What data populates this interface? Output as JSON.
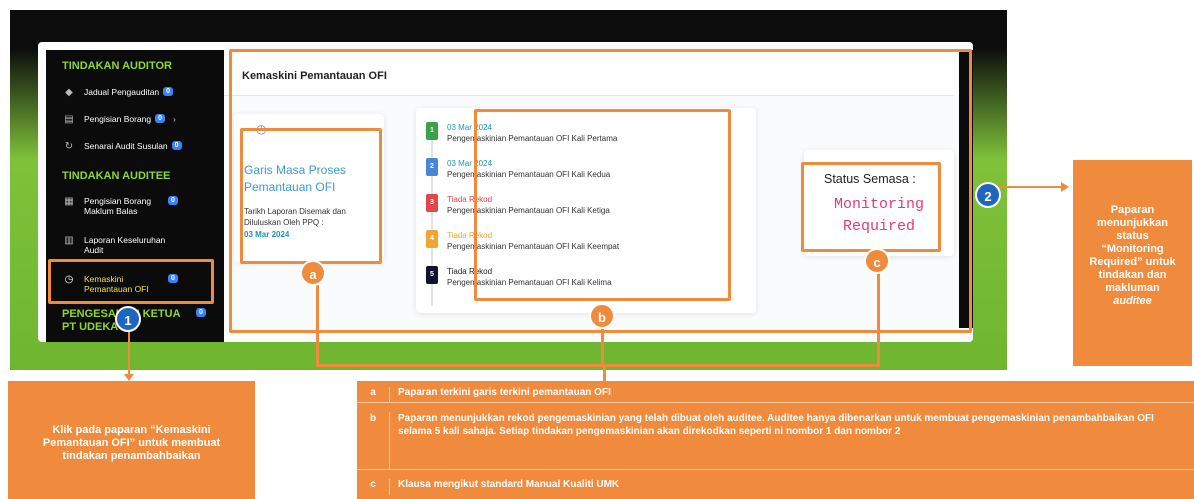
{
  "sidebar": {
    "section_auditor": "TINDAKAN AUDITOR",
    "section_auditee": "TINDAKAN AUDITEE",
    "section_pengesahan": "PENGESAHAN KETUA PT UDEKA",
    "items": [
      {
        "label": "Jadual Pengauditan",
        "badge": "0"
      },
      {
        "label": "Pengisian Borang",
        "badge": "0"
      },
      {
        "label": "Senarai Audit Susulan",
        "badge": "0"
      },
      {
        "label": "Pengisian Borang Maklum Balas",
        "badge": "0"
      },
      {
        "label": "Laporan Keseluruhan Audit",
        "badge": ""
      },
      {
        "label": "Kemaskini Pemantauan OFI",
        "badge": "0"
      }
    ],
    "pengesahan_badge": "0"
  },
  "main": {
    "title": "Kemaskini Pemantauan OFI"
  },
  "garis_masa": {
    "title": "Garis Masa Proses Pemantauan OFI",
    "subtitle": "Tarikh Laporan Disemak dan Diluluskan Oleh PPQ :",
    "date": "03 Mar 2024"
  },
  "timeline": [
    {
      "num": "1",
      "date": "03 Mar 2024",
      "text": "Pengemaskinian Pemantauan OFI Kali Pertama",
      "color": "#3aa34a",
      "date_color": "#1a96b8"
    },
    {
      "num": "2",
      "date": "03 Mar 2024",
      "text": "Pengemaskinian Pemantauan OFI Kali Kedua",
      "color": "#4a86d8",
      "date_color": "#1a96b8"
    },
    {
      "num": "3",
      "date": "Tiada Rekod",
      "text": "Pengemaskinian Pemantauan OFI Kali Ketiga",
      "color": "#e0474d",
      "date_color": "#e0474d"
    },
    {
      "num": "4",
      "date": "Tiada Rekod",
      "text": "Pengemaskinian Pemantauan OFI Kali Keempat",
      "color": "#f2a533",
      "date_color": "#f2a533"
    },
    {
      "num": "5",
      "date": "Tiada Rekod",
      "text": "Pengemaskinian Pemantauan OFI Kali Kelima",
      "color": "#12122a",
      "date_color": "#222"
    }
  ],
  "status": {
    "label": "Status Semasa :",
    "value_line1": "Monitoring",
    "value_line2": "Required",
    "value_color": "#e6397a"
  },
  "markers": {
    "one": "1",
    "two": "2",
    "a": "a",
    "b": "b",
    "c": "c"
  },
  "callout_right": {
    "line1": "Paparan",
    "line2": "menunjukkan",
    "line3": "status",
    "line4": "“Monitoring",
    "line5": "Required” untuk",
    "line6": "tindakan dan",
    "line7": "makluman",
    "line8": "auditee"
  },
  "callout_left": {
    "line1": "Klik pada paparan “Kemaskini",
    "line2": "Pemantauan OFI” untuk membuat",
    "line3": "tindakan penambahbaikan"
  },
  "legend": [
    {
      "key": "a",
      "text": "Paparan terkini garis terkini pemantauan OFI"
    },
    {
      "key": "b",
      "text": "Paparan menunjukkan rekod pengemaskinian yang telah dibuat oleh auditee. Auditee hanya dibenarkan untuk membuat pengemaskinian penambahbaikan OFI selama 5 kali sahaja. Setiap tindakan pengemaskinian akan direkodkan seperti ni nombor 1 dan nombor 2"
    },
    {
      "key": "c",
      "text": "Klausa mengikut standard Manual Kualiti UMK"
    }
  ],
  "colors": {
    "accent": "#f08a3c",
    "green": "#7fc23a",
    "marker_blue": "#1f66c1"
  }
}
